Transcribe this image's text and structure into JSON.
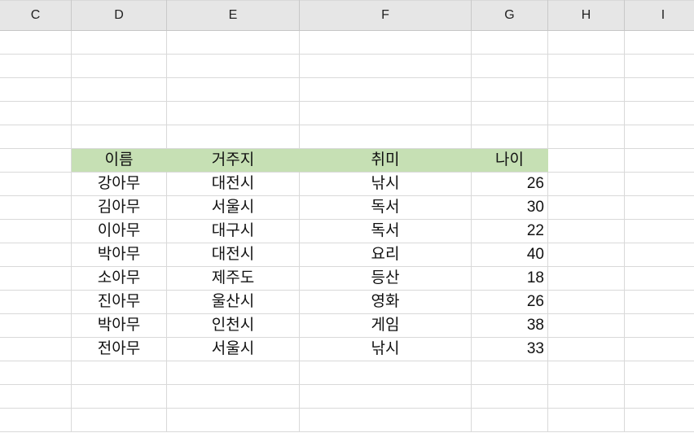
{
  "sheet": {
    "column_headers": [
      "C",
      "D",
      "E",
      "F",
      "G",
      "H",
      "I"
    ],
    "table_header": [
      "이름",
      "거주지",
      "취미",
      "나이"
    ],
    "rows": [
      [
        "강아무",
        "대전시",
        "낚시",
        "26"
      ],
      [
        "김아무",
        "서울시",
        "독서",
        "30"
      ],
      [
        "이아무",
        "대구시",
        "독서",
        "22"
      ],
      [
        "박아무",
        "대전시",
        "요리",
        "40"
      ],
      [
        "소아무",
        "제주도",
        "등산",
        "18"
      ],
      [
        "진아무",
        "울산시",
        "영화",
        "26"
      ],
      [
        "박아무",
        "인천시",
        "게임",
        "38"
      ],
      [
        "전아무",
        "서울시",
        "낚시",
        "33"
      ]
    ]
  },
  "colors": {
    "header_fill": "#c6e0b4",
    "gridline": "#d9d9d9",
    "column_header_bg": "#e6e6e6"
  }
}
